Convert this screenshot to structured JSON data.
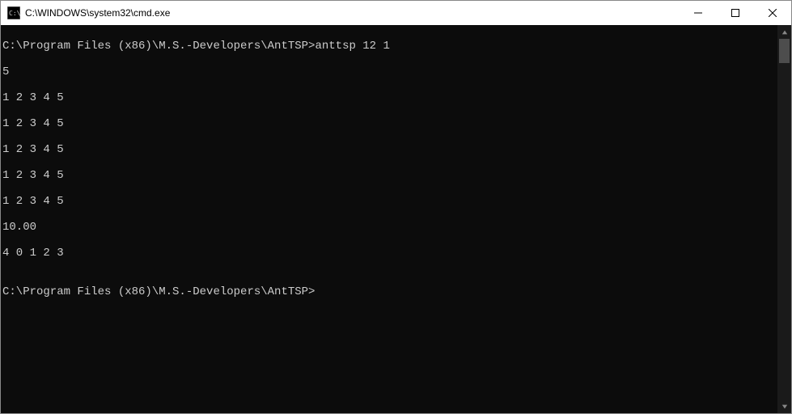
{
  "titlebar": {
    "title": "C:\\WINDOWS\\system32\\cmd.exe"
  },
  "terminal": {
    "lines": [
      "C:\\Program Files (x86)\\M.S.-Developers\\AntTSP>anttsp 12 1",
      "5",
      "1 2 3 4 5",
      "1 2 3 4 5",
      "1 2 3 4 5",
      "1 2 3 4 5",
      "1 2 3 4 5",
      "10.00",
      "4 0 1 2 3",
      "",
      "C:\\Program Files (x86)\\M.S.-Developers\\AntTSP>"
    ]
  }
}
